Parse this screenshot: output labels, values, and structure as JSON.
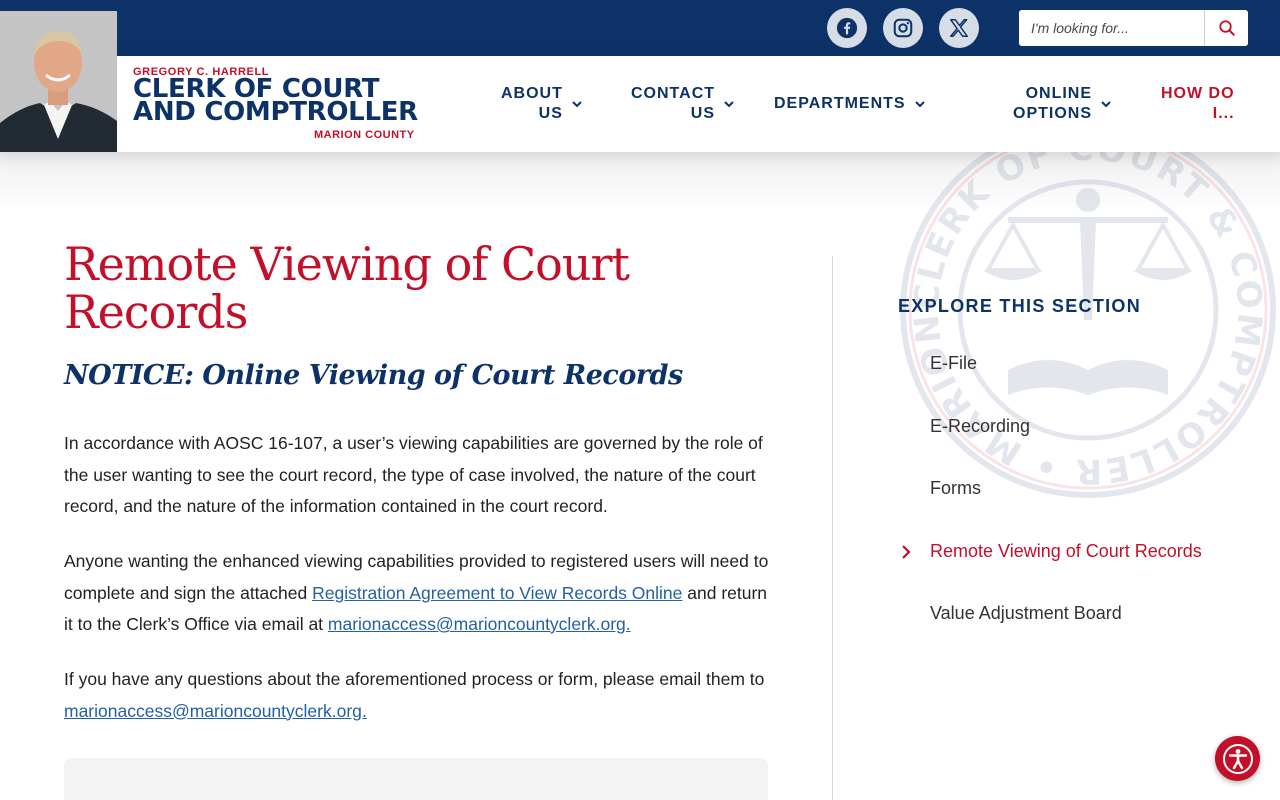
{
  "topbar": {
    "social": [
      {
        "name": "facebook-icon"
      },
      {
        "name": "instagram-icon"
      },
      {
        "name": "x-icon"
      }
    ],
    "search": {
      "placeholder": "I'm looking for..."
    }
  },
  "header": {
    "logo": {
      "small": "GREGORY C. HARRELL",
      "line1": "CLERK OF COURT",
      "line2": "AND COMPTROLLER",
      "county": "MARION COUNTY"
    },
    "nav": [
      {
        "line1": "ABOUT",
        "line2": "US"
      },
      {
        "line1": "CONTACT",
        "line2": "US"
      },
      {
        "line1": "DEPARTMENTS",
        "line2": ""
      },
      {
        "line1": "ONLINE",
        "line2": "OPTIONS"
      },
      {
        "line1": "HOW DO",
        "line2": "I..."
      }
    ]
  },
  "main": {
    "title": "Remote Viewing of Court Records",
    "subtitle": "NOTICE: Online Viewing of Court Records",
    "p1": "In accordance with AOSC 16-107, a user’s viewing capabilities are governed by the role of the user wanting to see the court record, the type of case involved, the nature of the court record, and the nature of the information contained in the court record.",
    "p2": {
      "before": "Anyone wanting the enhanced viewing capabilities provided to registered users will need to complete and sign the attached ",
      "link1": "Registration Agreement to View Records Online",
      "middle": " and return it to the Clerk’s Office via email at ",
      "link2": "marionaccess@marioncountyclerk.org."
    },
    "p3": {
      "before": "If you have any questions about the aforementioned process or form, please email them to ",
      "link": "marionaccess@marioncountyclerk.org."
    }
  },
  "sidebar": {
    "heading": "EXPLORE THIS SECTION",
    "items": [
      {
        "label": "E-File"
      },
      {
        "label": "E-Recording"
      },
      {
        "label": "Forms"
      },
      {
        "label": "Remote Viewing of Court Records"
      },
      {
        "label": "Value Adjustment Board"
      }
    ]
  },
  "seal": {
    "text": "CLERK OF COURT & COMPTROLLER • MARION COUNTY, FLORIDA •"
  },
  "colors": {
    "navy": "#0d3268",
    "red": "#c3102a",
    "link": "#2360a5"
  }
}
